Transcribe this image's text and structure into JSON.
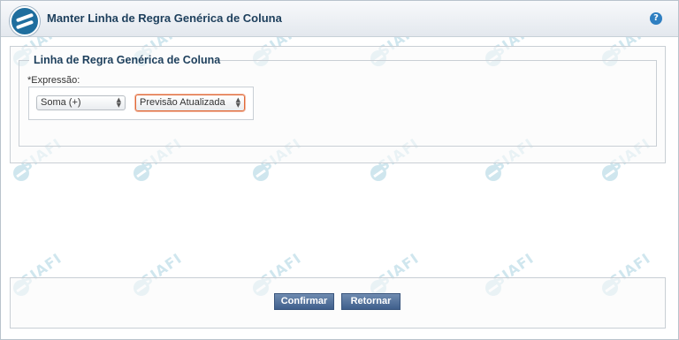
{
  "window": {
    "title": "Manter Linha de Regra Genérica de Coluna",
    "help_icon": "?"
  },
  "watermark": {
    "text": "SIAFI"
  },
  "form": {
    "legend": "Linha de Regra Genérica de Coluna",
    "expression_label": "*Expressão:",
    "operator_select": {
      "selected": "Soma (+)"
    },
    "item_select": {
      "selected": "Previsão Atualizada"
    }
  },
  "footer": {
    "confirm_label": "Confirmar",
    "return_label": "Retornar"
  },
  "colors": {
    "title_text": "#1d3f5c",
    "button_bg": "#4f6f9c",
    "highlight_border": "#e06a3a",
    "watermark": "#2a8fb4"
  },
  "icons": {
    "app_logo": "siafi-logo-icon",
    "help": "help-icon",
    "select_arrows": "updown-arrows-icon"
  }
}
